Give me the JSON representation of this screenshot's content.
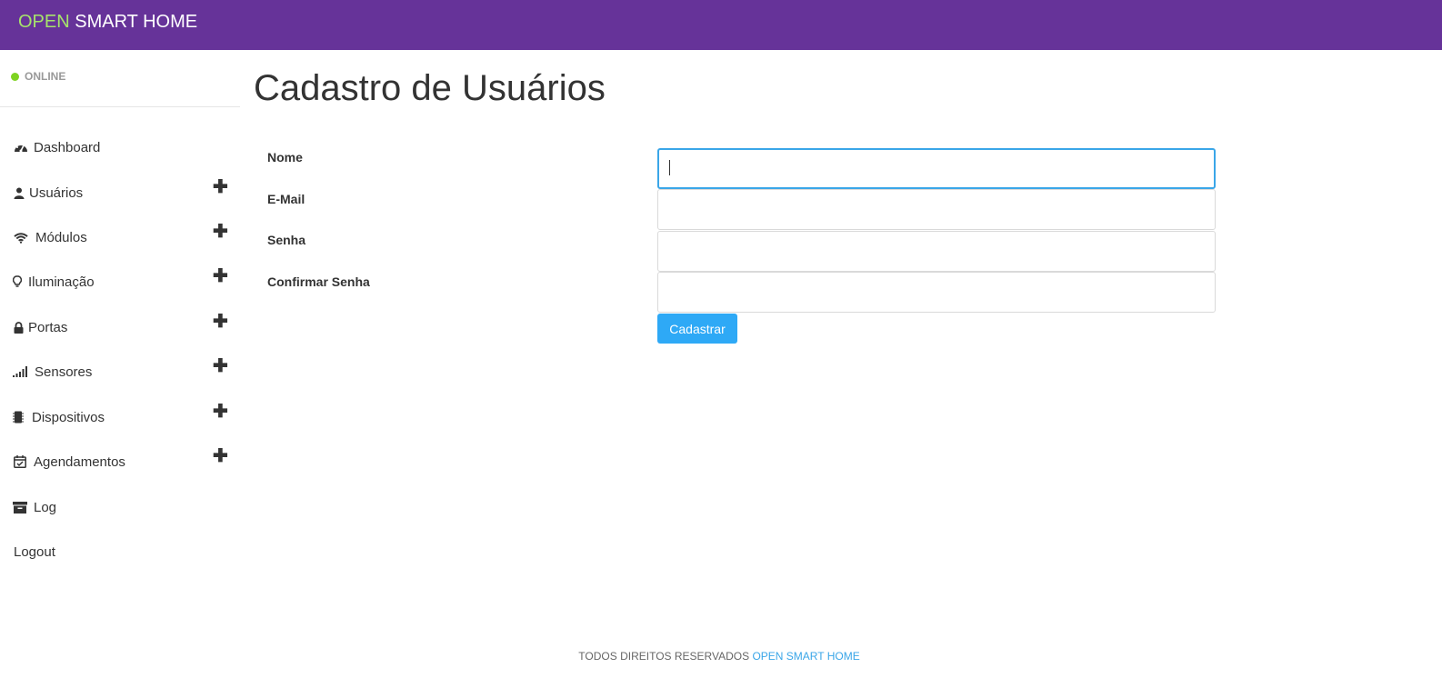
{
  "header": {
    "brand_accent": "OPEN",
    "brand_rest": " SMART HOME"
  },
  "sidebar": {
    "status": "ONLINE",
    "items": [
      {
        "label": "Dashboard",
        "icon": "dashboard-icon",
        "expandable": false
      },
      {
        "label": "Usuários",
        "icon": "user-icon",
        "expandable": true
      },
      {
        "label": "Módulos",
        "icon": "wifi-icon",
        "expandable": true
      },
      {
        "label": "Iluminação",
        "icon": "lightbulb-icon",
        "expandable": true
      },
      {
        "label": "Portas",
        "icon": "lock-icon",
        "expandable": true
      },
      {
        "label": "Sensores",
        "icon": "signal-icon",
        "expandable": true
      },
      {
        "label": "Dispositivos",
        "icon": "chip-icon",
        "expandable": true
      },
      {
        "label": "Agendamentos",
        "icon": "calendar-check-icon",
        "expandable": true
      },
      {
        "label": "Log",
        "icon": "archive-icon",
        "expandable": false
      },
      {
        "label": "Logout",
        "icon": "",
        "expandable": false
      }
    ],
    "plus_glyph": "✚"
  },
  "main": {
    "title": "Cadastro de Usuários",
    "form": {
      "fields": [
        {
          "label": "Nome",
          "value": "",
          "placeholder": ""
        },
        {
          "label": "E-Mail",
          "value": "",
          "placeholder": ""
        },
        {
          "label": "Senha",
          "value": "",
          "placeholder": ""
        },
        {
          "label": "Confirmar Senha",
          "value": "",
          "placeholder": ""
        }
      ],
      "submit_label": "Cadastrar"
    }
  },
  "footer": {
    "text": "TODOS DIREITOS RESERVADOS ",
    "link": "OPEN SMART HOME"
  },
  "colors": {
    "header_bg": "#663399",
    "brand_accent": "#a6e36b",
    "online_dot": "#7ed321",
    "primary": "#2ea9f6",
    "focus_border": "#3aa6e8"
  }
}
